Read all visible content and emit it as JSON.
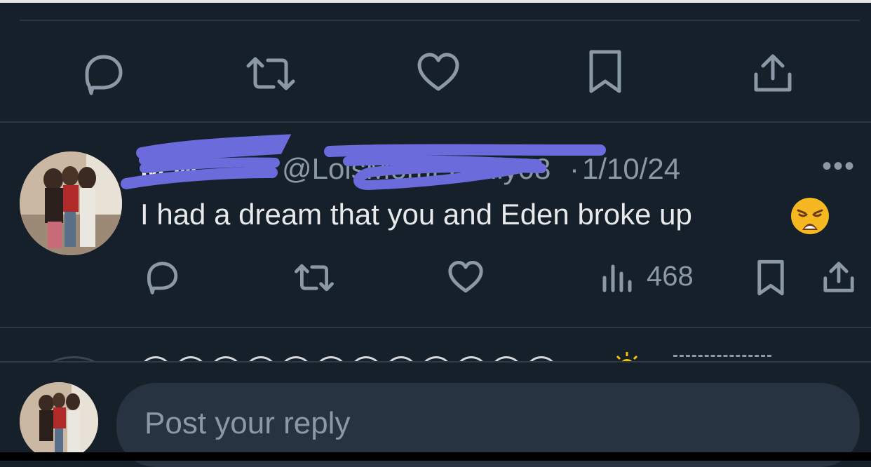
{
  "tweet": {
    "display_name": "M     M",
    "handle": "@LoisMomFamily08",
    "separator": "·",
    "date": "1/10/24",
    "more": "•••",
    "text": "I had a dream that you and Eden broke up",
    "emoji": "weary-face",
    "views": "468"
  },
  "composer": {
    "placeholder": "Post your reply"
  },
  "colors": {
    "background": "#15202b",
    "text": "#e7e9ea",
    "muted": "#8b98a5",
    "scribble": "#6b6bdc",
    "input_bg": "#273340"
  },
  "icons": {
    "reply": "reply-icon",
    "retweet": "retweet-icon",
    "like": "like-icon",
    "bookmark": "bookmark-icon",
    "share": "share-icon",
    "views": "views-icon",
    "more": "more-icon"
  }
}
